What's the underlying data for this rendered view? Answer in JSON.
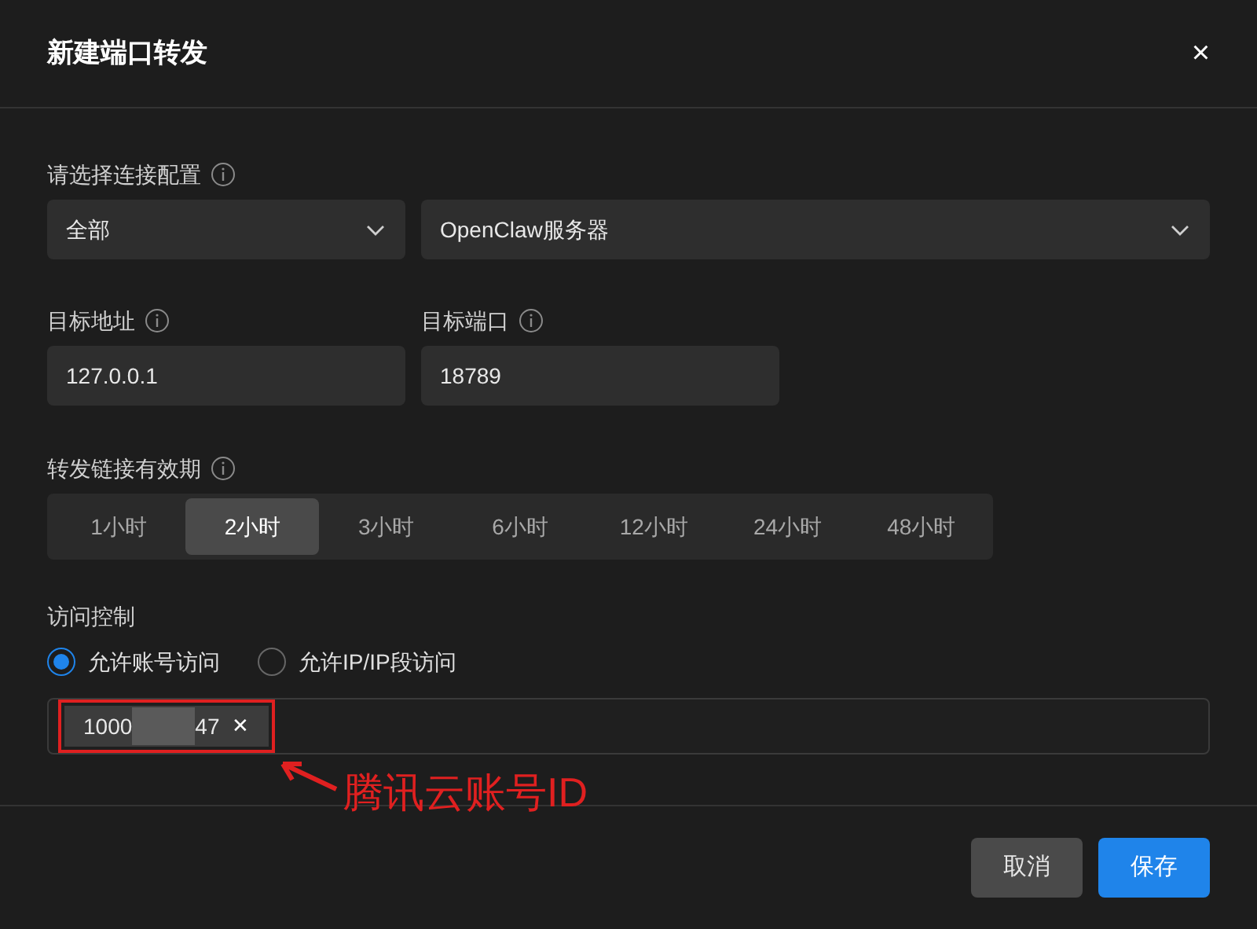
{
  "dialog": {
    "title": "新建端口转发",
    "close": "×"
  },
  "connection": {
    "label": "请选择连接配置",
    "selects": [
      {
        "value": "全部"
      },
      {
        "value": "OpenClaw服务器"
      }
    ]
  },
  "target": [
    {
      "label": "目标地址",
      "value": "127.0.0.1"
    },
    {
      "label": "目标端口",
      "value": "18789"
    }
  ],
  "duration": {
    "label": "转发链接有效期",
    "options": [
      {
        "label": "1小时",
        "selected": false
      },
      {
        "label": "2小时",
        "selected": true
      },
      {
        "label": "3小时",
        "selected": false
      },
      {
        "label": "6小时",
        "selected": false
      },
      {
        "label": "12小时",
        "selected": false
      },
      {
        "label": "24小时",
        "selected": false
      },
      {
        "label": "48小时",
        "selected": false
      }
    ]
  },
  "access": {
    "label": "访问控制",
    "radios": [
      {
        "label": "允许账号访问",
        "selected": true
      },
      {
        "label": "允许IP/IP段访问",
        "selected": false
      }
    ],
    "tags": [
      {
        "start": "1000",
        "end": "47",
        "remove": "✕"
      }
    ]
  },
  "annotation": {
    "text": "腾讯云账号ID"
  },
  "buttons": [
    {
      "label": "取消",
      "kind": "secondary"
    },
    {
      "label": "保存",
      "kind": "primary"
    }
  ]
}
